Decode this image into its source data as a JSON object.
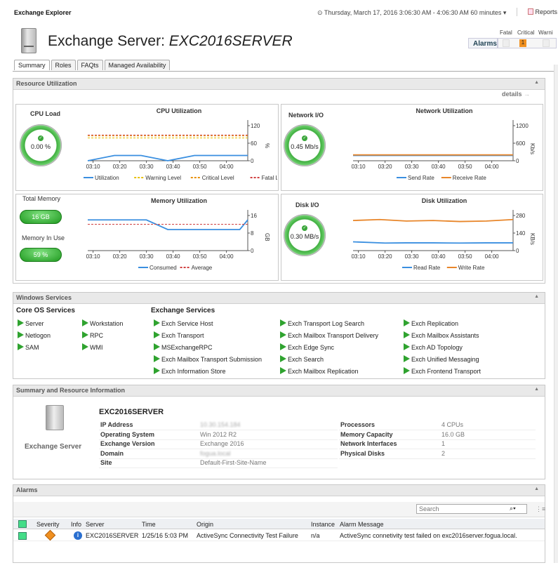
{
  "app_title": "Exchange Explorer",
  "time_range": "Thursday, March 17, 2016 3:06:30 AM - 4:06:30 AM 60 minutes",
  "reports_label": "Reports",
  "server_title_prefix": "Exchange Server: ",
  "server_title_name": "EXC2016SERVER",
  "alarms_summary": {
    "label": "Alarms",
    "headers": [
      "Fatal",
      "Critical",
      "Warni"
    ],
    "critical_count": "1"
  },
  "tabs": [
    "Summary",
    "Roles",
    "FAQts",
    "Managed Availability"
  ],
  "resource": {
    "title": "Resource Utilization",
    "details": "details",
    "cpu_load_label": "CPU Load",
    "cpu_load_value": "0.00 %",
    "network_io_label": "Network I/O",
    "network_io_value": "0.45 Mb/s",
    "total_memory_label": "Total Memory",
    "total_memory_value": "16 GB",
    "memory_in_use_label": "Memory In Use",
    "memory_in_use_value": "59 %",
    "disk_io_label": "Disk I/O",
    "disk_io_value": "0.30 MB/s"
  },
  "charts": {
    "cpu": {
      "title": "CPU Utilization",
      "yunit": "%",
      "legend": [
        "Utilization",
        "Warning Level",
        "Critical Level",
        "Fatal Level"
      ]
    },
    "network": {
      "title": "Network Utilization",
      "yunit": "Kb/s",
      "legend": [
        "Send Rate",
        "Receive Rate"
      ]
    },
    "memory": {
      "title": "Memory Utilization",
      "yunit": "GB",
      "legend": [
        "Consumed",
        "Average"
      ]
    },
    "disk": {
      "title": "Disk Utilization",
      "yunit": "KB/s",
      "legend": [
        "Read Rate",
        "Write Rate"
      ]
    }
  },
  "chart_data": [
    {
      "type": "line",
      "title": "CPU Utilization",
      "x": [
        "03:10",
        "03:20",
        "03:30",
        "03:40",
        "03:50",
        "04:00"
      ],
      "yticks": [
        "0",
        "60",
        "120"
      ],
      "ylim": [
        0,
        120
      ],
      "series": [
        {
          "name": "Utilization",
          "color": "#3a8fe0",
          "points": [
            [
              0,
              0
            ],
            [
              1,
              18
            ],
            [
              2,
              18
            ],
            [
              3,
              0
            ],
            [
              4,
              18
            ],
            [
              5,
              18
            ],
            [
              6,
              18
            ]
          ]
        },
        {
          "name": "Warning Level",
          "color": "#e8c000",
          "points": [
            [
              0,
              78
            ],
            [
              6,
              78
            ]
          ]
        },
        {
          "name": "Critical Level",
          "color": "#e89000",
          "points": [
            [
              0,
              85
            ],
            [
              6,
              85
            ]
          ]
        },
        {
          "name": "Fatal Level",
          "color": "#d04040",
          "points": [
            [
              0,
              88
            ],
            [
              6,
              88
            ]
          ]
        }
      ]
    },
    {
      "type": "line",
      "title": "Network Utilization",
      "x": [
        "03:10",
        "03:20",
        "03:30",
        "03:40",
        "03:50",
        "04:00"
      ],
      "yticks": [
        "0",
        "600",
        "1200"
      ],
      "ylim": [
        0,
        1200
      ],
      "series": [
        {
          "name": "Send Rate",
          "color": "#3a8fe0",
          "points": [
            [
              0,
              180
            ],
            [
              6,
              180
            ]
          ]
        },
        {
          "name": "Receive Rate",
          "color": "#e8862a",
          "points": [
            [
              0,
              200
            ],
            [
              6,
              200
            ]
          ]
        }
      ]
    },
    {
      "type": "line",
      "title": "Memory Utilization",
      "x": [
        "03:10",
        "03:20",
        "03:30",
        "03:40",
        "03:50",
        "04:00"
      ],
      "yticks": [
        "0",
        "8",
        "16"
      ],
      "ylim": [
        0,
        16
      ],
      "series": [
        {
          "name": "Consumed",
          "color": "#3a8fe0",
          "points": [
            [
              0,
              14
            ],
            [
              2.2,
              14
            ],
            [
              3,
              9.6
            ],
            [
              5.7,
              9.6
            ],
            [
              6,
              14
            ]
          ]
        },
        {
          "name": "Average",
          "color": "#d04040",
          "points": [
            [
              0,
              12
            ],
            [
              6,
              12
            ]
          ]
        }
      ]
    },
    {
      "type": "line",
      "title": "Disk Utilization",
      "x": [
        "03:10",
        "03:20",
        "03:30",
        "03:40",
        "03:50",
        "04:00"
      ],
      "yticks": [
        "0",
        "140",
        "280"
      ],
      "ylim": [
        0,
        280
      ],
      "series": [
        {
          "name": "Read Rate",
          "color": "#3a8fe0",
          "points": [
            [
              0,
              70
            ],
            [
              1.2,
              60
            ],
            [
              2,
              62
            ],
            [
              3,
              62
            ],
            [
              4,
              60
            ],
            [
              5,
              62
            ],
            [
              6,
              62
            ]
          ]
        },
        {
          "name": "Write Rate",
          "color": "#e8862a",
          "points": [
            [
              0,
              240
            ],
            [
              1,
              248
            ],
            [
              2,
              236
            ],
            [
              3,
              240
            ],
            [
              4,
              232
            ],
            [
              5,
              236
            ],
            [
              6,
              248
            ]
          ]
        }
      ]
    }
  ],
  "windows_services": {
    "title": "Windows Services",
    "core_title": "Core OS Services",
    "core": [
      "Server",
      "Netlogon",
      "SAM",
      "Workstation",
      "RPC",
      "WMI"
    ],
    "exchange_title": "Exchange Services",
    "exchange_col1": [
      "Exch Service Host",
      "Exch Transport",
      "MSExchangeRPC",
      "Exch Mailbox Transport Submission",
      "Exch Information Store"
    ],
    "exchange_col2": [
      "Exch Transport Log Search",
      "Exch Mailbox Transport Delivery",
      "Exch Edge Sync",
      "Exch Search",
      "Exch Mailbox Replication"
    ],
    "exchange_col3": [
      "Exch Replication",
      "Exch Mailbox Assistants",
      "Exch AD Topology",
      "Exch Unified Messaging",
      "Exch Frontend Transport"
    ]
  },
  "summary": {
    "title": "Summary and Resource Information",
    "icon_label": "Exchange Server",
    "server_name": "EXC2016SERVER",
    "left": [
      {
        "k": "IP Address",
        "v": "10.30.154.184"
      },
      {
        "k": "Operating System",
        "v": "Win 2012 R2"
      },
      {
        "k": "Exchange Version",
        "v": "Exchange 2016"
      },
      {
        "k": "Domain",
        "v": "fogua.local"
      },
      {
        "k": "Site",
        "v": "Default-First-Site-Name"
      }
    ],
    "right": [
      {
        "k": "Processors",
        "v": "4 CPUs"
      },
      {
        "k": "Memory Capacity",
        "v": "16.0 GB"
      },
      {
        "k": "Network Interfaces",
        "v": "1"
      },
      {
        "k": "Physical Disks",
        "v": "2"
      }
    ]
  },
  "alarms": {
    "title": "Alarms",
    "search_placeholder": "Search",
    "columns": [
      "Severity",
      "Info",
      "Server",
      "Time",
      "Origin",
      "Instance",
      "Alarm Message"
    ],
    "row": {
      "server": "EXC2016SERVER",
      "time": "1/25/16 5:03 PM",
      "origin": "ActiveSync Connectivity Test Failure",
      "instance": "n/a",
      "message": "ActiveSync connetivity test failed on exc2016server.fogua.local."
    }
  }
}
